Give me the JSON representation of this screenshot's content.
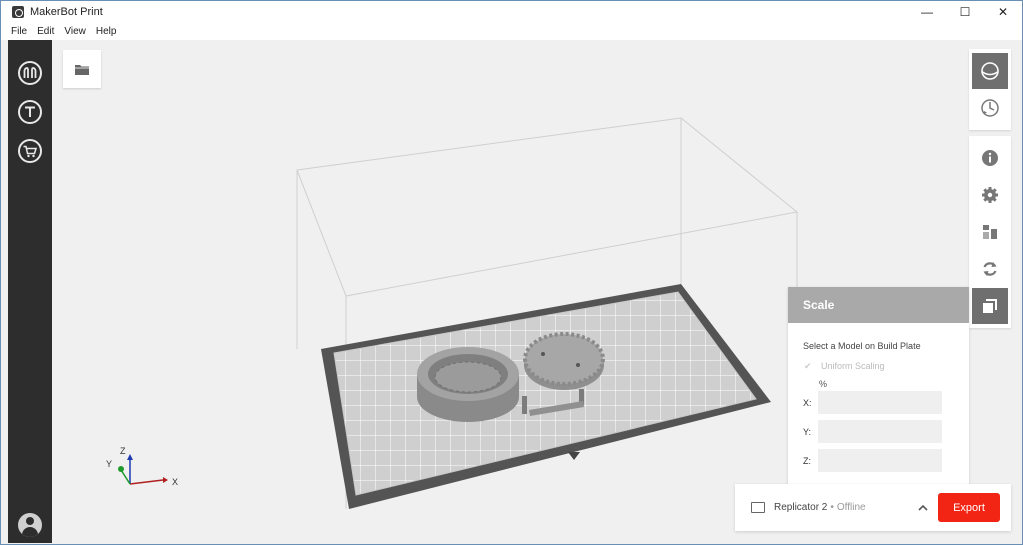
{
  "window": {
    "title": "MakerBot Print",
    "controls": {
      "minimize": "—",
      "maximize": "☐",
      "close": "✕"
    }
  },
  "menu": {
    "items": [
      "File",
      "Edit",
      "View",
      "Help"
    ]
  },
  "sidebar": {
    "items": [
      {
        "icon": "makerbot-logo-icon",
        "glyph": "M"
      },
      {
        "icon": "thingiverse-icon",
        "glyph": "T"
      },
      {
        "icon": "store-cart-icon",
        "glyph": "🛒"
      }
    ],
    "avatar": "account-avatar"
  },
  "toolbar": {
    "open_icon": "folder-icon"
  },
  "right_tools": {
    "view_group": [
      "views-icon",
      "preview-icon"
    ],
    "edit_group": [
      "info-icon",
      "settings-icon",
      "arrange-icon",
      "rotate-icon",
      "scale-icon"
    ],
    "active": "scale-icon"
  },
  "scale_panel": {
    "title": "Scale",
    "hint": "Select a Model on Build Plate",
    "uniform_label": "Uniform Scaling",
    "unit": "%",
    "fields": [
      {
        "label": "X:",
        "value": ""
      },
      {
        "label": "Y:",
        "value": ""
      },
      {
        "label": "Z:",
        "value": ""
      }
    ]
  },
  "axes": {
    "x": "X",
    "y": "Y",
    "z": "Z",
    "colors": {
      "x": "#b02020",
      "y": "#1d9a2a",
      "z": "#1d3ab0"
    }
  },
  "printer": {
    "name": "Replicator 2",
    "separator": "•",
    "status": "Offline",
    "export_label": "Export"
  },
  "colors": {
    "accent": "#f22414",
    "sidebar": "#2d2d2d",
    "active_tool": "#6f6f6f",
    "panel_header": "#a9a9a9"
  }
}
